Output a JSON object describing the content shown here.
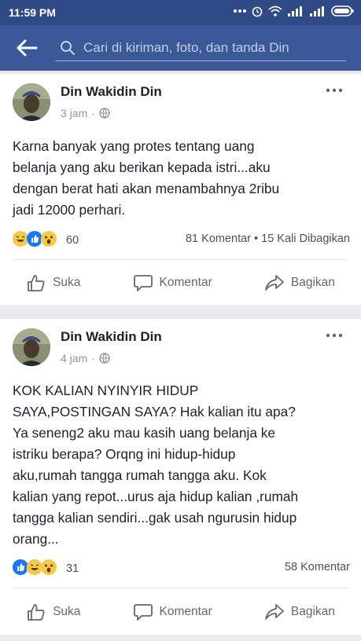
{
  "status": {
    "time": "11:59 PM"
  },
  "search": {
    "placeholder": "Cari di kiriman, foto, dan tanda Din"
  },
  "posts": [
    {
      "author": "Din Wakidin Din",
      "time": "3 jam",
      "text": "Karna banyak yang protes tentang uang\nbelanja yang aku berikan kepada istri...aku\ndengan berat hati akan menambahnya 2ribu\njadi 12000 perhari.",
      "reaction_count": "60",
      "stats": "81 Komentar • 15 Kali Dibagikan"
    },
    {
      "author": "Din Wakidin Din",
      "time": "4 jam",
      "text": "KOK KALIAN NYINYIR HIDUP\nSAYA,POSTINGAN SAYA? Hak kalian itu apa?\nYa seneng2 aku mau kasih uang belanja ke\nistriku berapa? Orqng ini hidup-hidup\naku,rumah tangga rumah tangga aku. Kok\nkalian yang repot...urus aja hidup kalian ,rumah\ntangga kalian sendiri...gak usah ngurusin hidup\norang...",
      "reaction_count": "31",
      "stats": "58 Komentar"
    }
  ],
  "actions": {
    "like": "Suka",
    "comment": "Komentar",
    "share": "Bagikan"
  },
  "colors": {
    "brand": "#3b5998",
    "statusbar": "#2f4a86",
    "like_blue": "#1877f2",
    "emoji_yellow": "#f7c948"
  }
}
